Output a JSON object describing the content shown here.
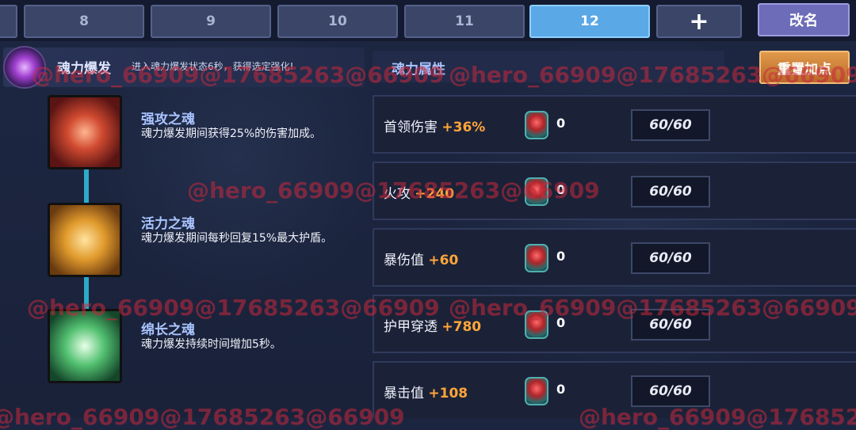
{
  "tabs": [
    {
      "label": ""
    },
    {
      "label": "8"
    },
    {
      "label": "9"
    },
    {
      "label": "10"
    },
    {
      "label": "11"
    },
    {
      "label": "12",
      "active": true
    },
    {
      "label": "+"
    }
  ],
  "rename_label": "改名",
  "burst": {
    "title": "魂力爆发",
    "desc": "进入魂力爆发状态6秒，获得选定强化!"
  },
  "souls": [
    {
      "name": "强攻之魂",
      "desc": "魂力爆发期间获得25%的伤害加成。",
      "icon": "fire-soul-icon"
    },
    {
      "name": "活力之魂",
      "desc": "魂力爆发期间每秒回复15%最大护盾。",
      "icon": "shield-soul-icon"
    },
    {
      "name": "绵长之魂",
      "desc": "魂力爆发持续时间增加5秒。",
      "icon": "clock-soul-icon"
    }
  ],
  "attr_title": "魂力属性",
  "reset_label": "重置加点",
  "attributes": [
    {
      "label": "首领伤害",
      "bonus": "+36%",
      "gem_count": "0",
      "level": "60/60"
    },
    {
      "label": "火攻",
      "bonus": "+240",
      "gem_count": "0",
      "level": "60/60"
    },
    {
      "label": "暴伤值",
      "bonus": "+60",
      "gem_count": "0",
      "level": "60/60"
    },
    {
      "label": "护甲穿透",
      "bonus": "+780",
      "gem_count": "0",
      "level": "60/60"
    },
    {
      "label": "暴击值",
      "bonus": "+108",
      "gem_count": "0",
      "level": "60/60"
    }
  ],
  "watermark": "@hero_66909@17685263@66909",
  "colors": {
    "accent_tab": "#5aa8e6",
    "bonus": "#ffa53a",
    "reset": "#d0843e",
    "connector": "#2ea9c9"
  }
}
